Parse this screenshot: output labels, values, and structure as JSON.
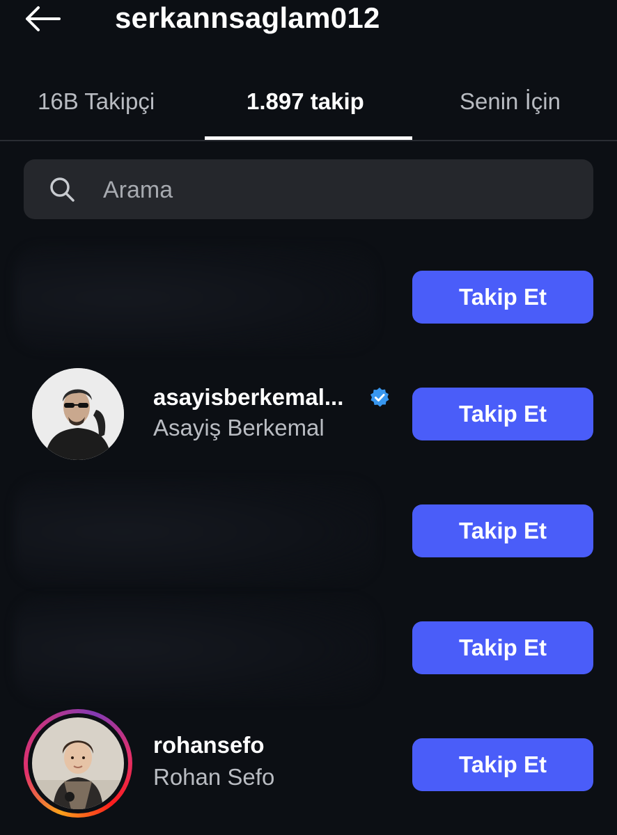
{
  "header": {
    "title": "serkannsaglam012",
    "back_icon": "arrow-left-icon"
  },
  "tabs": [
    {
      "label": "16B Takipçi",
      "active": false
    },
    {
      "label": "1.897 takip",
      "active": true
    },
    {
      "label": "Senin İçin",
      "active": false
    }
  ],
  "search": {
    "placeholder": "Arama",
    "value": "",
    "icon": "search-icon"
  },
  "list": [
    {
      "username": "",
      "full_name": "",
      "verified": false,
      "has_story": false,
      "blurred": true,
      "button": "Takip Et"
    },
    {
      "username": "asayisberkemal...",
      "full_name": "Asayiş Berkemal",
      "verified": true,
      "has_story": false,
      "blurred": false,
      "button": "Takip Et"
    },
    {
      "username": "",
      "full_name": "",
      "verified": false,
      "has_story": false,
      "blurred": true,
      "button": "Takip Et"
    },
    {
      "username": "",
      "full_name": "",
      "verified": false,
      "has_story": false,
      "blurred": true,
      "button": "Takip Et"
    },
    {
      "username": "rohansefo",
      "full_name": "Rohan Sefo",
      "verified": false,
      "has_story": true,
      "blurred": false,
      "button": "Takip Et"
    }
  ],
  "colors": {
    "background": "#0c0f14",
    "button": "#4a5df9",
    "verified": "#3897f0",
    "search_bg": "#25272c",
    "secondary_text": "#b9bcc2"
  }
}
